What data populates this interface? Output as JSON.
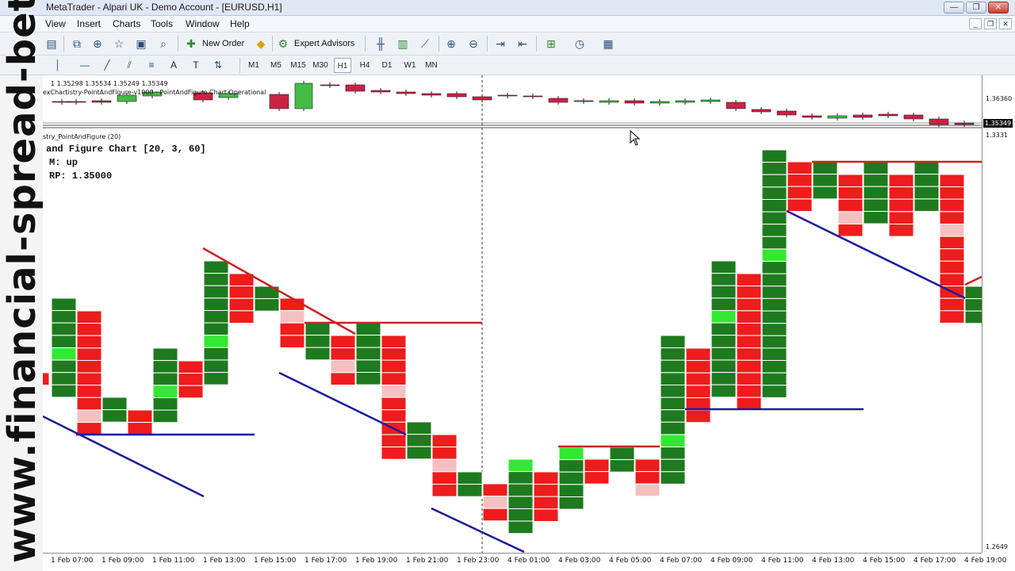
{
  "window": {
    "title": "MetaTrader - Alpari UK - Demo Account - [EURUSD,H1]",
    "minimize_glyph": "—",
    "restore_glyph": "❐",
    "close_glyph": "✕"
  },
  "menu": {
    "items": [
      "View",
      "Insert",
      "Charts",
      "Tools",
      "Window",
      "Help"
    ],
    "mdi_minimize": "_",
    "mdi_restore": "❐",
    "mdi_close": "✕"
  },
  "toolbar": {
    "new_order_label": "New Order",
    "expert_advisors_label": "Expert Advisors",
    "icons": [
      "new-chart-icon",
      "profiles-icon",
      "crosshair-icon",
      "navigator-icon",
      "terminal-icon",
      "strategy-tester-icon",
      "new-order-icon",
      "metaeditor-icon",
      "expert-advisors-icon",
      "bar-chart-icon",
      "candlestick-icon",
      "line-chart-icon",
      "zoom-in-icon",
      "zoom-out-icon",
      "auto-scroll-icon",
      "chart-shift-icon",
      "indicators-icon",
      "periods-icon",
      "templates-icon"
    ],
    "side_tab_glyph": "4"
  },
  "drawing_toolbar": {
    "tools": [
      "cursor-icon",
      "vertical-line-icon",
      "horizontal-line-icon",
      "trendline-icon",
      "equidistant-channel-icon",
      "fibonacci-icon",
      "text-icon",
      "text-label-icon",
      "arrows-icon"
    ],
    "text_tool": "A",
    "text_label_tool": "T",
    "timeframes": [
      "M1",
      "M5",
      "M15",
      "M30",
      "H1",
      "H4",
      "D1",
      "W1",
      "MN"
    ],
    "active_timeframe": "H1"
  },
  "chart": {
    "symbol": "EURUSD",
    "timeframe": "H1",
    "info_line": "1  1.35298 1.35534 1.35249 1.35349",
    "indicator_line": "exChartistry-PointAndFigure-v1000 - PointAndFigure Chart Operational",
    "subwindow_label": "stry_PointAndFigure (20)",
    "pf_title": "and Figure Chart [20, 3, 60]",
    "pf_direction": "M: up",
    "pf_rp": "RP: 1.35000",
    "price_labels": {
      "main_level": "1.36360",
      "current_price": "1.35349",
      "sub_top": "1.3331",
      "sub_bottom": "1.2649"
    },
    "time_labels": [
      "1 Feb 07:00",
      "1 Feb 09:00",
      "1 Feb 11:00",
      "1 Feb 13:00",
      "1 Feb 15:00",
      "1 Feb 17:00",
      "1 Feb 19:00",
      "1 Feb 21:00",
      "1 Feb 23:00",
      "4 Feb 01:00",
      "4 Feb 03:00",
      "4 Feb 05:00",
      "4 Feb 07:00",
      "4 Feb 09:00",
      "4 Feb 11:00",
      "4 Feb 13:00",
      "4 Feb 15:00",
      "4 Feb 17:00",
      "4 Feb 19:00"
    ],
    "colors": {
      "box_up": "#1e7a1e",
      "box_up_light": "#33e833",
      "box_down": "#ee1c1c",
      "box_down_light": "#f5c0c0",
      "resistance": "#cc2222",
      "support": "#1a1aa0",
      "bull_candle": "#44bb44",
      "bear_candle": "#cc2244"
    }
  },
  "watermark": "www.financial-spread-betting.com"
}
